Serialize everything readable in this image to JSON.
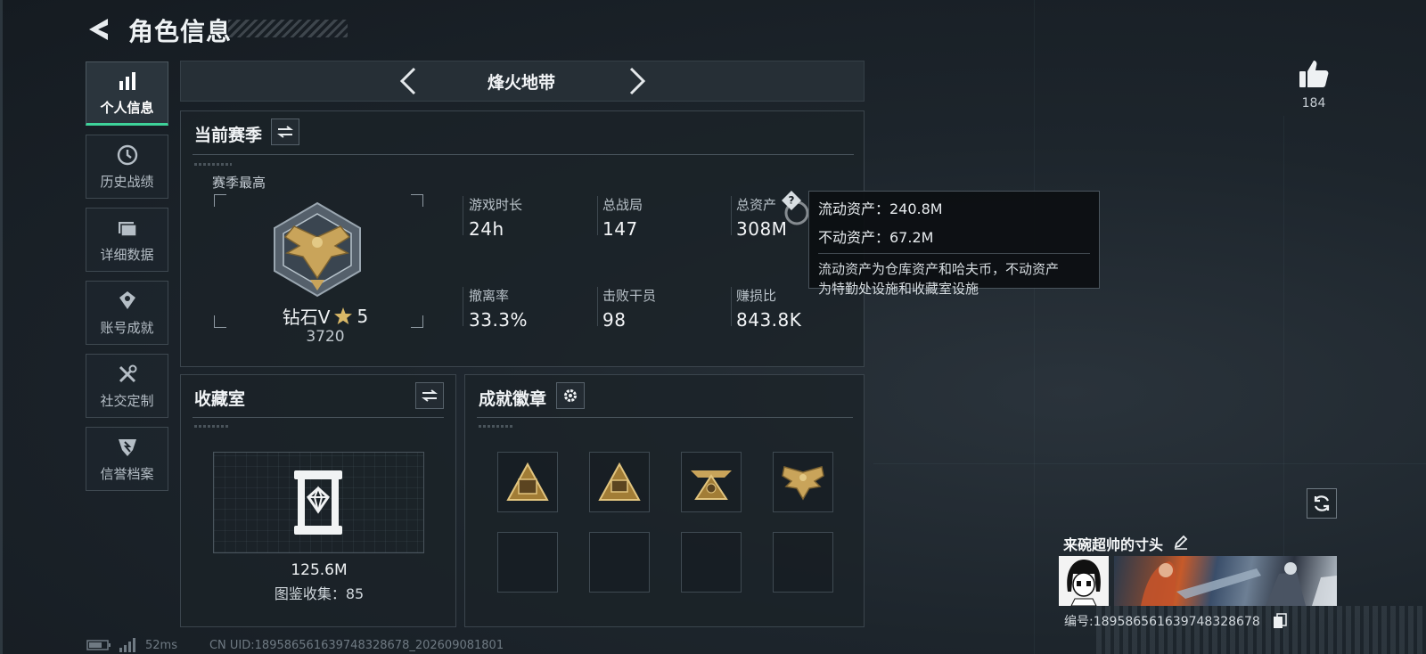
{
  "header": {
    "title": "角色信息"
  },
  "nav": {
    "items": [
      {
        "label": "个人信息",
        "icon": "bar-chart-icon",
        "active": true
      },
      {
        "label": "历史战绩",
        "icon": "history-icon",
        "active": false
      },
      {
        "label": "详细数据",
        "icon": "folder-icon",
        "active": false
      },
      {
        "label": "账号成就",
        "icon": "achievement-icon",
        "active": false
      },
      {
        "label": "社交定制",
        "icon": "tools-icon",
        "active": false
      },
      {
        "label": "信誉档案",
        "icon": "reputation-icon",
        "active": false
      }
    ]
  },
  "mode": {
    "name": "烽火地带"
  },
  "season": {
    "title": "当前赛季",
    "best_label": "赛季最高",
    "rank_name": "钻石V",
    "rank_stars": "5",
    "rank_score": "3720",
    "stats": [
      {
        "label": "游戏时长",
        "value": "24h"
      },
      {
        "label": "总战局",
        "value": "147"
      },
      {
        "label": "总资产",
        "value": "308M"
      },
      {
        "label": "撤离率",
        "value": "33.3%"
      },
      {
        "label": "击败干员",
        "value": "98"
      },
      {
        "label": "赚损比",
        "value": "843.8K"
      }
    ]
  },
  "tooltip": {
    "liquid": "流动资产：240.8M",
    "fixed": "不动资产：67.2M",
    "desc_line1": "流动资产为仓库资产和哈夫币，不动资产",
    "desc_line2": "为特勤处设施和收藏室设施"
  },
  "collection": {
    "title": "收藏室",
    "value": "125.6M",
    "catalog": "图鉴收集：85"
  },
  "badges": {
    "title": "成就徽章",
    "items": [
      "badge-pyramid-icon",
      "badge-pyramid-58-icon",
      "badge-crown-icon",
      "badge-eagle-icon"
    ]
  },
  "profile": {
    "likes": "184",
    "name": "来碗超帅的寸头",
    "id": "编号:18958656163974832867​8"
  },
  "footer": {
    "ping": "52ms",
    "uid": "CN UID:18958656163974832867​8_202609081801"
  },
  "colors": {
    "accent": "#3ed39a",
    "gold": "#c9a45a"
  }
}
